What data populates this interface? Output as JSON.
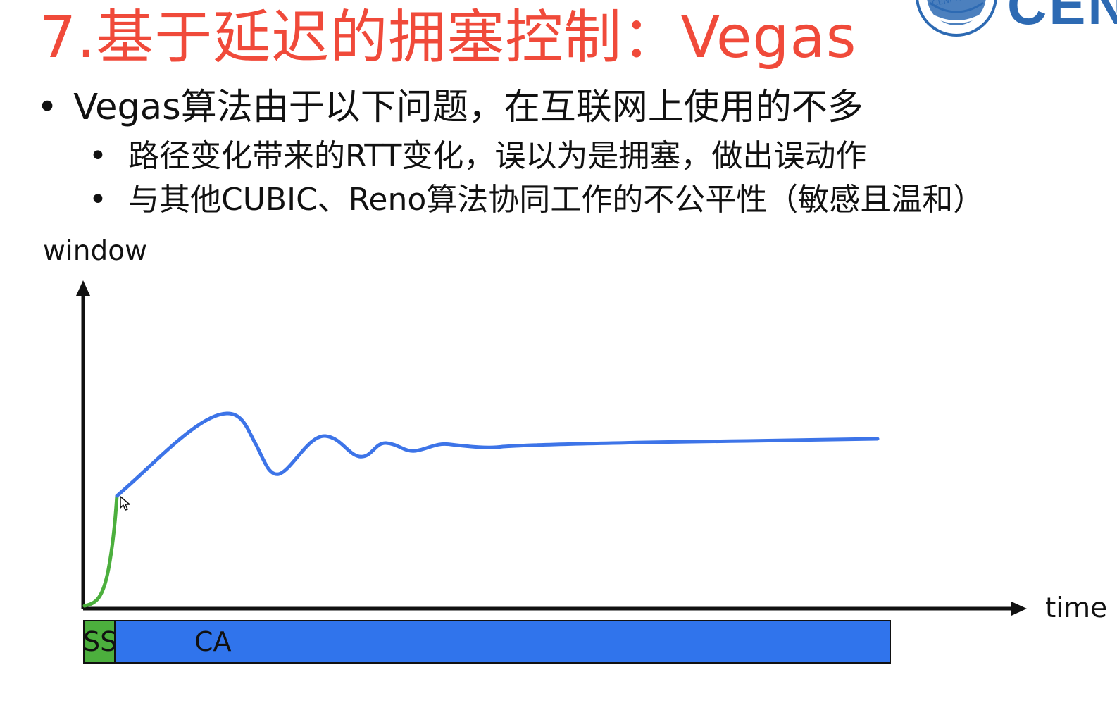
{
  "slide": {
    "title": "7.基于延迟的拥塞控制：Vegas",
    "bullet_main": "Vegas算法由于以下问题，在互联网上使用的不多",
    "sub_bullets": [
      "路径变化带来的RTT变化，误以为是拥塞，做出误动作",
      "与其他CUBIC、Reno算法协同工作的不公平性（敏感且温和）"
    ]
  },
  "logo": {
    "word": "CEN",
    "text": "CENI-HEFEI"
  },
  "chart": {
    "y_label": "window",
    "x_label": "time",
    "phase_labels": {
      "ss": "SS",
      "ca": "CA"
    },
    "colors": {
      "ss": "#4caf3d",
      "ca": "#3074ec",
      "axis": "#111111",
      "title": "#f04a3a"
    }
  },
  "icons": {
    "bullet": "bullet-dot",
    "arrow_up": "arrow-up-icon",
    "arrow_right": "arrow-right-icon",
    "cursor": "mouse-cursor-icon"
  }
}
